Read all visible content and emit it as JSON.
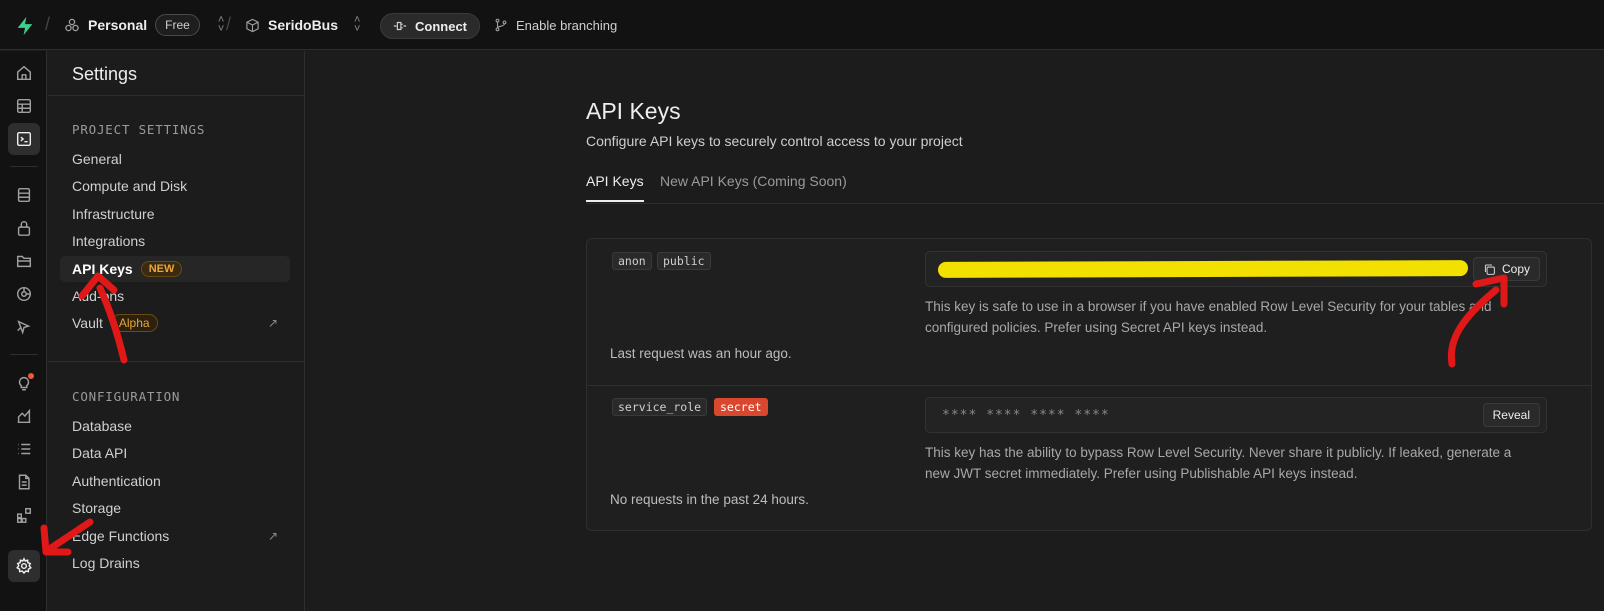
{
  "topbar": {
    "org": "Personal",
    "plan": "Free",
    "project": "SeridoBus",
    "connect_label": "Connect",
    "branching_label": "Enable branching"
  },
  "sidebar": {
    "title": "Settings",
    "project_section": "PROJECT SETTINGS",
    "project_items": [
      "General",
      "Compute and Disk",
      "Infrastructure",
      "Integrations",
      "API Keys",
      "Add-ons",
      "Vault"
    ],
    "new_badge": "NEW",
    "alpha_badge": "Alpha",
    "config_section": "CONFIGURATION",
    "config_items": [
      "Database",
      "Data API",
      "Authentication",
      "Storage",
      "Edge Functions",
      "Log Drains"
    ]
  },
  "main": {
    "title": "API Keys",
    "subtitle": "Configure API keys to securely control access to your project",
    "tabs": [
      "API Keys",
      "New API Keys (Coming Soon)"
    ],
    "anon": {
      "tags": [
        "anon",
        "public"
      ],
      "copy_label": "Copy",
      "help": "This key is safe to use in a browser if you have enabled Row Level Security for your tables and configured policies. Prefer using Secret API keys instead.",
      "last_request": "Last request was an hour ago."
    },
    "service": {
      "tags": [
        "service_role",
        "secret"
      ],
      "masked_value": "**** **** **** ****",
      "reveal_label": "Reveal",
      "help": "This key has the ability to bypass Row Level Security. Never share it publicly. If leaked, generate a new JWT secret immediately. Prefer using Publishable API keys instead.",
      "last_request": "No requests in the past 24 hours."
    }
  },
  "colors": {
    "accent_green": "#3ecf8e",
    "secret_red": "#d9472f",
    "redaction_yellow": "#f2e000",
    "annotation_red": "#e01818"
  }
}
